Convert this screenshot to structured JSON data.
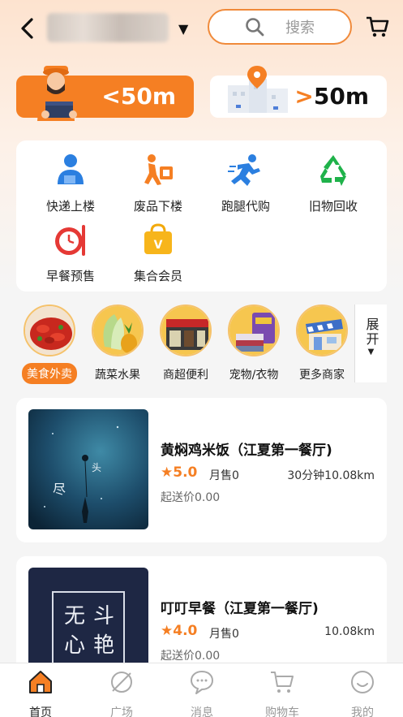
{
  "header": {
    "location_name": "",
    "search_placeholder": "搜索"
  },
  "distance_tabs": {
    "near": "<50m",
    "far_symbol": ">",
    "far_value": "50m"
  },
  "services": [
    {
      "label": "快递上楼",
      "icon": "courier-icon"
    },
    {
      "label": "废品下楼",
      "icon": "waste-icon"
    },
    {
      "label": "跑腿代购",
      "icon": "runner-icon"
    },
    {
      "label": "旧物回收",
      "icon": "recycle-icon"
    },
    {
      "label": "早餐预售",
      "icon": "breakfast-icon"
    },
    {
      "label": "集合会员",
      "icon": "vip-bag-icon"
    }
  ],
  "categories": [
    {
      "label": "美食外卖",
      "active": true
    },
    {
      "label": "蔬菜水果",
      "active": false
    },
    {
      "label": "商超便利",
      "active": false
    },
    {
      "label": "宠物/衣物",
      "active": false
    },
    {
      "label": "更多商家",
      "active": false
    }
  ],
  "expand_label": "展开",
  "shops": [
    {
      "name": "黄焖鸡米饭（江夏第一餐厅)",
      "rating": "5.0",
      "sales": "月售0",
      "distance": "30分钟10.08km",
      "min_order": "起送价0.00"
    },
    {
      "name": "叮叮早餐（江夏第一餐厅)",
      "rating": "4.0",
      "sales": "月售0",
      "distance": "10.08km",
      "min_order": "起送价0.00"
    }
  ],
  "bottom_nav": [
    {
      "label": "首页",
      "active": true
    },
    {
      "label": "广场",
      "active": false
    },
    {
      "label": "消息",
      "active": false
    },
    {
      "label": "购物车",
      "active": false
    },
    {
      "label": "我的",
      "active": false
    }
  ],
  "colors": {
    "accent": "#f57f23",
    "blue": "#2b7fe0",
    "green": "#1fb24a",
    "red": "#e53935"
  }
}
